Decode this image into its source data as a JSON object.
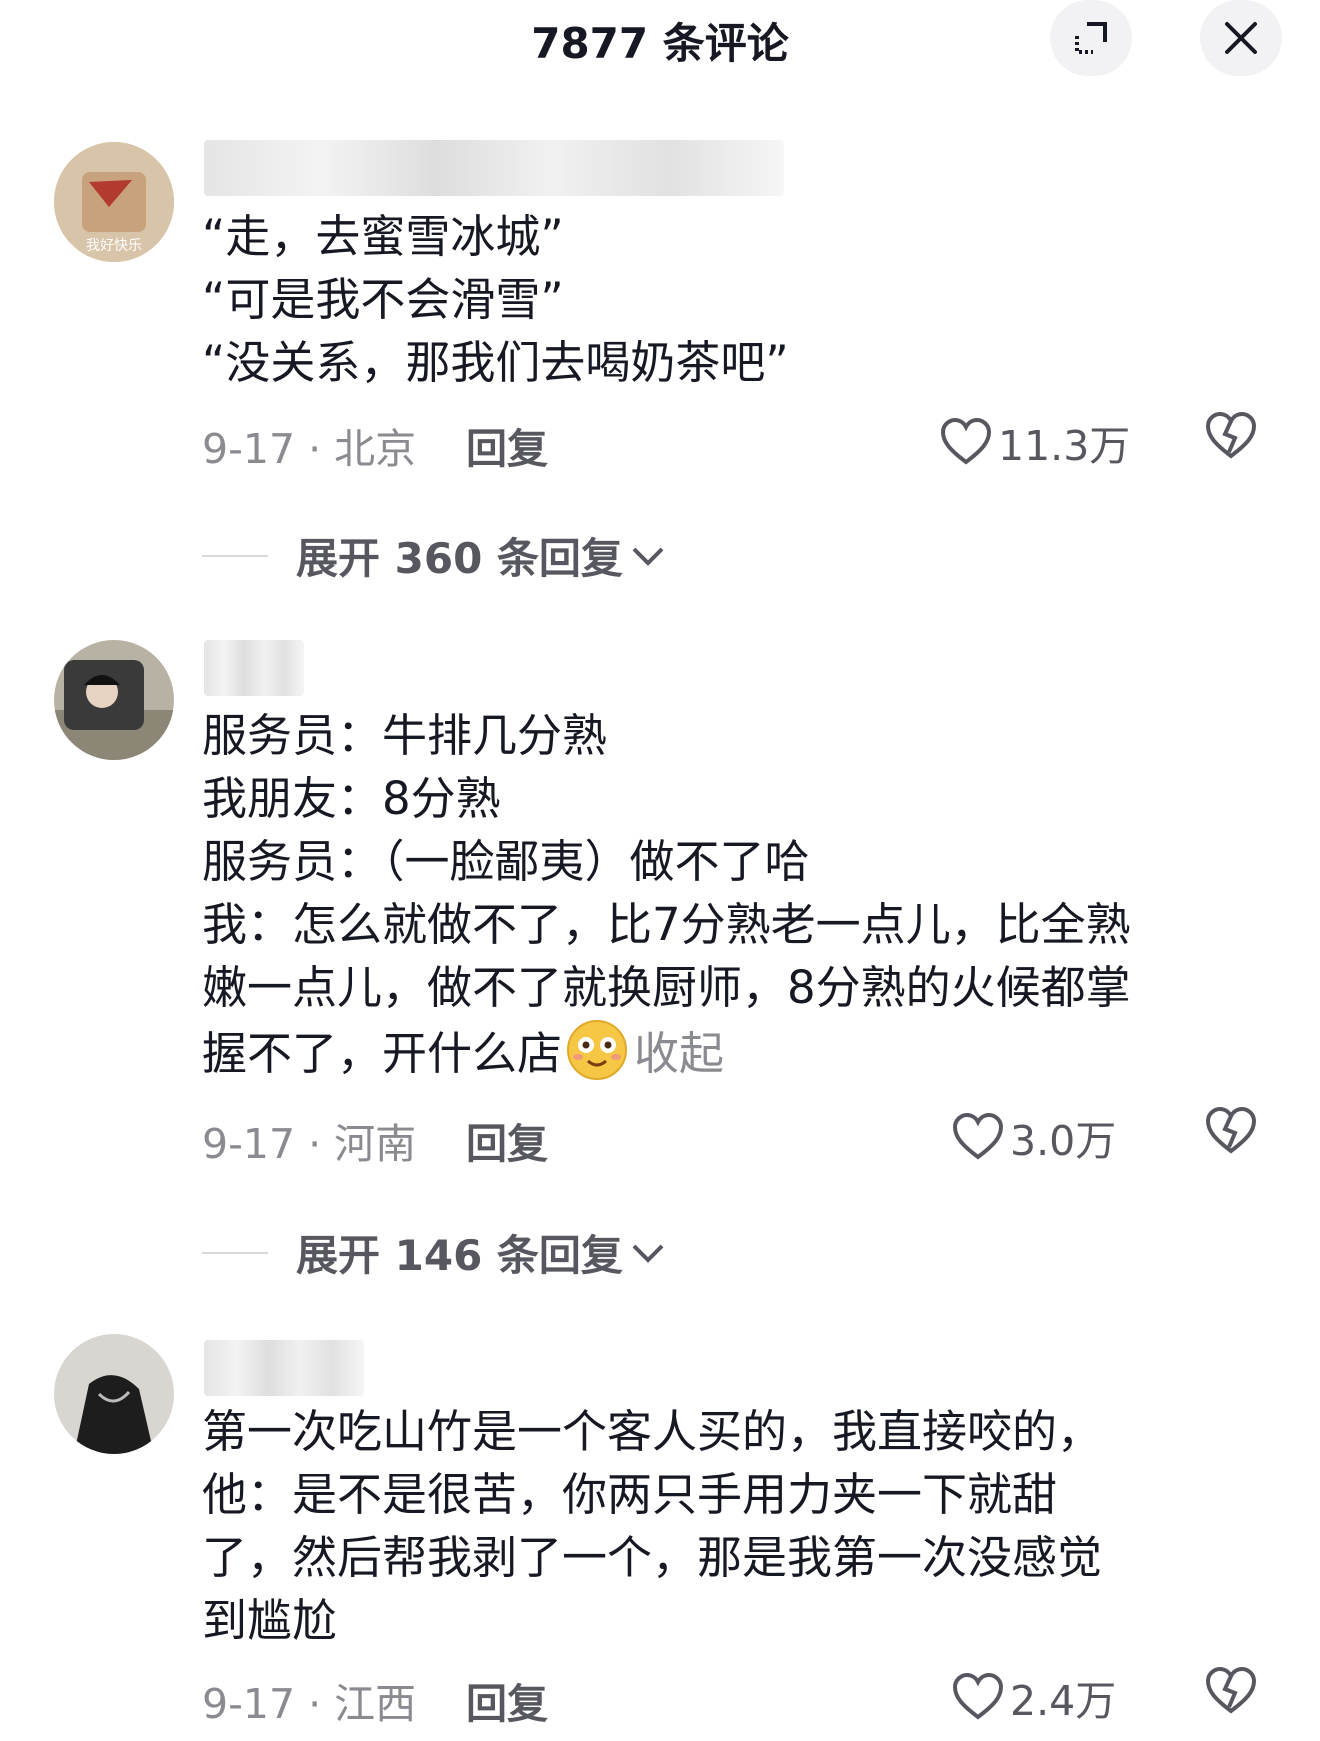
{
  "header": {
    "title": "7877 条评论"
  },
  "comments": [
    {
      "lines": [
        "“走，去蜜雪冰城”",
        "“可是我不会滑雪”",
        "“没关系，那我们去喝奶茶吧”"
      ],
      "date_location": "9-17 · 北京",
      "reply_label": "回复",
      "likes": "11.3万",
      "avatar_text": "我好快乐",
      "expand_label": "展开 360 条回复"
    },
    {
      "lines": [
        "服务员：牛排几分熟",
        "我朋友：8分熟",
        "服务员：（一脸鄙夷）做不了哈",
        "我：怎么就做不了，比7分熟老一点儿，比全熟",
        "嫩一点儿，做不了就换厨师，8分熟的火候都掌",
        "握不了，开什么店"
      ],
      "collapse_label": "收起",
      "date_location": "9-17 · 河南",
      "reply_label": "回复",
      "likes": "3.0万",
      "expand_label": "展开 146 条回复"
    },
    {
      "lines": [
        "第一次吃山竹是一个客人买的，我直接咬的，",
        "他：是不是很苦，你两只手用力夹一下就甜",
        "了，然后帮我剥了一个，那是我第一次没感觉",
        "到尴尬"
      ],
      "date_location": "9-17 · 江西",
      "reply_label": "回复",
      "likes": "2.4万"
    }
  ],
  "icons": [
    "expand-icon",
    "close-icon",
    "heart-icon",
    "dislike-heart-icon",
    "chevron-down-icon",
    "smile-emoji-icon"
  ],
  "colors": {
    "text_primary": "#161823",
    "text_secondary": "#8a8b91",
    "action_gray": "#57585f",
    "button_bg": "#f2f2f4"
  }
}
